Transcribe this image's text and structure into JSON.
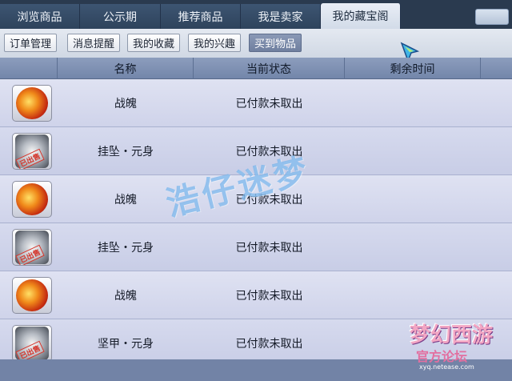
{
  "tabs": [
    {
      "label": "浏览商品",
      "active": false
    },
    {
      "label": "公示期",
      "active": false
    },
    {
      "label": "推荐商品",
      "active": false
    },
    {
      "label": "我是卖家",
      "active": false
    },
    {
      "label": "我的藏宝阁",
      "active": true
    }
  ],
  "subtabs": [
    {
      "label": "订单管理",
      "active": false
    },
    {
      "label": "消息提醒",
      "active": false
    },
    {
      "label": "我的收藏",
      "active": false
    },
    {
      "label": "我的兴趣",
      "active": false
    },
    {
      "label": "买到物品",
      "active": true
    }
  ],
  "table": {
    "headers": [
      "名称",
      "当前状态",
      "剩余时间"
    ],
    "rows": [
      {
        "name": "战魄",
        "status": "已付款未取出",
        "remaining": "",
        "icon": "zhanpo-fire-icon",
        "stamped": false
      },
      {
        "name": "挂坠・元身",
        "status": "已付款未取出",
        "remaining": "",
        "icon": "pendant-equipment-icon",
        "stamped": true
      },
      {
        "name": "战魄",
        "status": "已付款未取出",
        "remaining": "",
        "icon": "zhanpo-fire-icon",
        "stamped": false
      },
      {
        "name": "挂坠・元身",
        "status": "已付款未取出",
        "remaining": "",
        "icon": "pendant-equipment-icon",
        "stamped": true
      },
      {
        "name": "战魄",
        "status": "已付款未取出",
        "remaining": "",
        "icon": "zhanpo-fire-icon",
        "stamped": false
      },
      {
        "name": "坚甲・元身",
        "status": "已付款未取出",
        "remaining": "",
        "icon": "armor-equipment-icon",
        "stamped": true
      }
    ]
  },
  "watermark": "浩仔迷梦",
  "logo": {
    "title": "梦幻西游",
    "subtitle": "官方论坛",
    "url": "xyq.netease.com"
  },
  "colors": {
    "accent": "#7386aa",
    "watermark": "#78b4eb"
  }
}
